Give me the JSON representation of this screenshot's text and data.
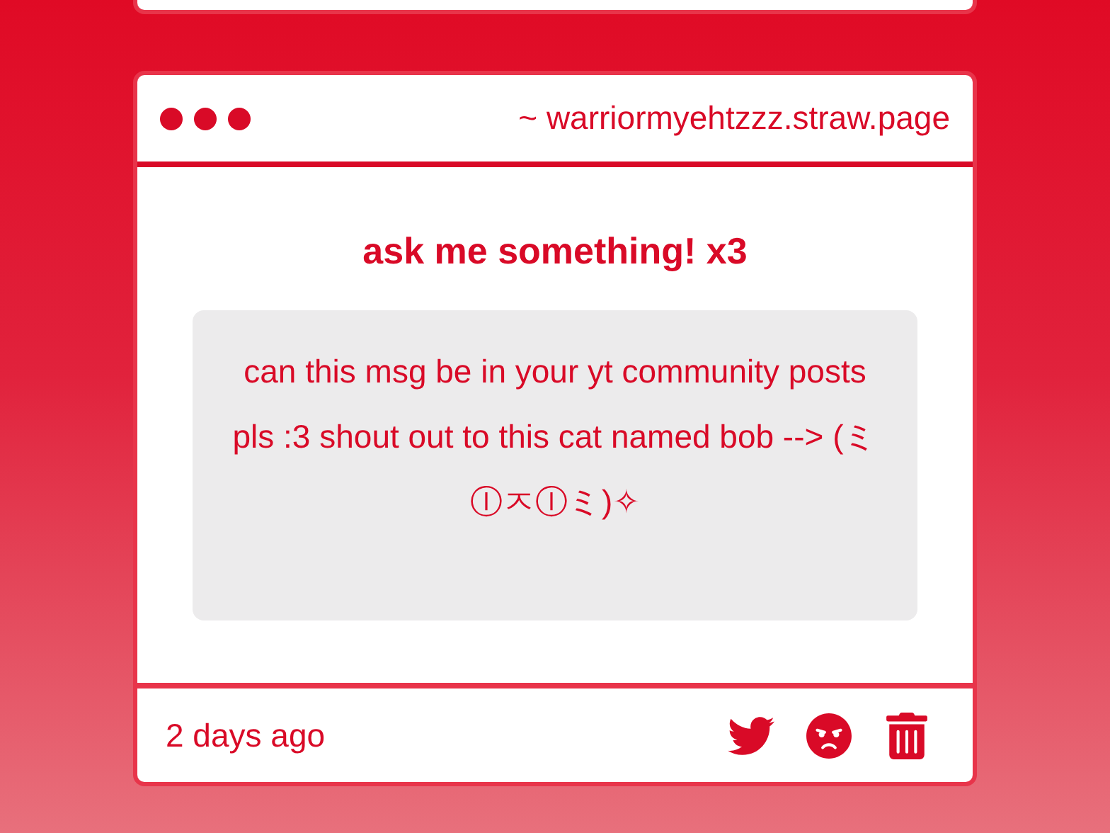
{
  "previous_card": {
    "kind": "card"
  },
  "card": {
    "url": "~ warriormyehtzzz.straw.page",
    "title": "ask me something! x3",
    "message": "can this msg be in your yt community posts pls :3 shout out to this cat named bob --> (ミⒾㅈⒾミ)✧",
    "time": "2 days ago"
  }
}
